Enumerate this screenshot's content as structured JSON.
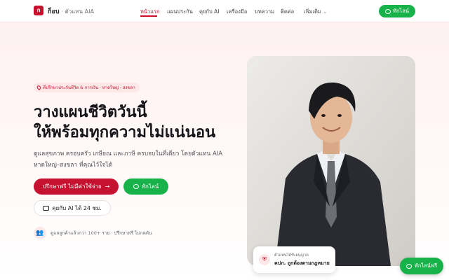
{
  "nav": {
    "logo_letter": "ก",
    "brand_name": "ก็อบ",
    "brand_sub": "· ตัวแทน AIA",
    "items": [
      {
        "label": "หน้าแรก",
        "active": true
      },
      {
        "label": "แผนประกัน"
      },
      {
        "label": "คุยกับ AI"
      },
      {
        "label": "เครื่องมือ"
      },
      {
        "label": "บทความ"
      },
      {
        "label": "ติดต่อ"
      },
      {
        "label": "เพิ่มเติม"
      }
    ],
    "line_button": "ทักไลน์"
  },
  "hero": {
    "tagline": "ที่ปรึกษาประกันชีวิต & การเงิน · หาดใหญ่ - สงขลา",
    "title_line1": "วางแผนชีวิตวันนี้",
    "title_line2": "ให้พร้อมทุกความไม่แน่นอน",
    "lead": "ดูแลสุขภาพ ครอบครัว เกษียณ และภาษี ครบจบในที่เดียว โดยตัวแทน AIA หาดใหญ่–สงขลา ที่คุณไว้ใจได้",
    "cta_primary": "ปรึกษาฟรี ไม่มีค่าใช้จ่าย",
    "cta_line": "ทักไลน์",
    "cta_ai": "คุยกับ AI ได้ 24 ชม.",
    "trust_text": "ดูแลลูกค้าแล้วกว่า 100+ ราย · ปรึกษาฟรี ไม่กดดัน"
  },
  "badge": {
    "small": "ตัวแทนได้รับอนุญาต",
    "main": "คปภ. ถูกต้องตามกฎหมาย"
  },
  "float_line": "ทักไลน์ฟรี",
  "colors": {
    "brand_red": "#c8102e",
    "line_green": "#17b34a"
  }
}
